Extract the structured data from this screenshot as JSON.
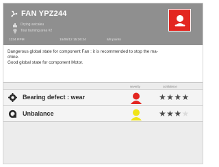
{
  "header": {
    "title": "FAN YPZ244",
    "subtitle_1": "Drying avicaleu",
    "subtitle_2": "Tour burning area #2",
    "rpm": "1234 RPM",
    "timestamp": "15/06/12 15:36:24",
    "points": "6/8 points",
    "background_color": "#8f8f8f",
    "alarm_color": "#e32620"
  },
  "message": {
    "line_1": "Dangerous global state for component Fan : it is recommended to stop the ma-",
    "line_2": "chine.",
    "line_3": "Good global state for component Motor."
  },
  "table": {
    "columns": {
      "severity": "severity",
      "confidence": "confidence"
    },
    "rows": [
      {
        "label": "Bearing defect : wear",
        "icon": "gear-icon",
        "severity_color": "#e32620",
        "confidence_stars": 4,
        "max_stars": 4
      },
      {
        "label": "Unbalance",
        "icon": "unbalance-icon",
        "severity_color": "#f0e418",
        "confidence_stars": 3,
        "max_stars": 4
      }
    ]
  }
}
